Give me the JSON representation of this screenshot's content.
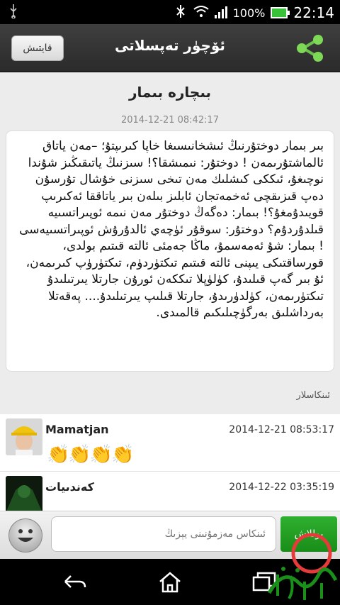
{
  "status_bar": {
    "battery": "100%",
    "time": "22:14",
    "usb_icon": "usb-icon",
    "signal_icon": "signal-icon",
    "wifi_icon": "wifi-icon"
  },
  "top_bar": {
    "back_label": "قايتىش",
    "title": "ئۆچۈر تەپسلاتى",
    "share_icon": "share-icon",
    "accent": "#3aa63a"
  },
  "article": {
    "title": "بىچارە بىمار",
    "date": "2014-12-21 08:42:17",
    "body": "بىر بىمار دوختۇرنىڭ ئىشخانىسىغا خاپا كىرىپتۇ؛ –مەن ياتاق ئالماشتۇرىمەن ! دوختۇر: نىمىشقا؟! سىزنىڭ ياتىقىڭىز شۇندا نوچىغۇ، ئىككى كىشلىك مەن تىخى سىزنى خۇشال تۇرسۇن دەپ قىزىقچى ئەخمەتجان ئابلىز بىلەن بىر ياتاققا ئەكىرىپ قويىدۇمغۇ؟! بىمار: دەگەڭ دوختۇر مەن نىمە ئوپىراتسىيە قىلدۇردۇم؟ دوختۇر: سوقۇر ئۈچەي ئالدۇرۇش ئوپىراتسىيەسى ! بىمار: شۇ ئەمەسمۇ، ماڭا جەمئى ئالتە قىتىم بولدى، قورساقتىكى يىپنى ئالتە قىتىم تىكتۈردۈم، تىكتۈرۈپ كىرىمەن، ئۇ بىر گەپ قىلىدۇ، كۈلۈپلا تىككەن ئورۇن جارتلا يىرتىلىدۇ تىكتۈرىمەن، كۈلدۈرىدۇ، جارتلا قىلىپ يىرتىلىدۇ.... پەقەتلا بەرداشلىق بەرگۈچىلىكىم قالمىدى."
  },
  "comments": {
    "label": "ئىنكاسلار",
    "items": [
      {
        "user": "Mamatjan",
        "time": "2014-12-21 08:53:17",
        "text": "👏👏👏👏"
      },
      {
        "user": "كەندىيات",
        "time": "2014-12-22 03:35:19",
        "text": ""
      }
    ]
  },
  "input_bar": {
    "placeholder": "ئىنكاس مەزمۇنىنى يېزىڭ",
    "send_label": "يوللاش",
    "emoji_icon": "emoji-icon"
  },
  "nav_bar": {
    "back_icon": "back-icon",
    "home_icon": "home-icon",
    "recents_icon": "recents-icon"
  }
}
